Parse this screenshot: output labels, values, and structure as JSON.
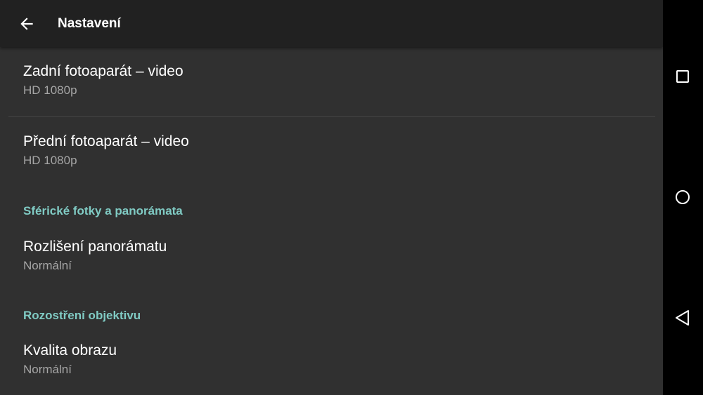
{
  "toolbar": {
    "title": "Nastavení",
    "back_icon": "arrow-back-icon"
  },
  "preferences": {
    "rear_video": {
      "title": "Zadní fotoaparát – video",
      "summary": "HD 1080p"
    },
    "front_video": {
      "title": "Přední fotoaparát – video",
      "summary": "HD 1080p"
    },
    "panorama_category": "Sférické fotky a panorámata",
    "panorama_resolution": {
      "title": "Rozlišení panorámatu",
      "summary": "Normální"
    },
    "lens_blur_category": "Rozostření objektivu",
    "image_quality": {
      "title": "Kvalita obrazu",
      "summary": "Normální"
    }
  },
  "navbar": {
    "recents_icon": "square-recents-icon",
    "home_icon": "circle-home-icon",
    "back_icon": "triangle-back-icon"
  },
  "colors": {
    "background": "#303030",
    "toolbar": "#212121",
    "accent": "#80cbc4",
    "primary_text": "#ffffff",
    "secondary_text": "#a6a6a6"
  }
}
